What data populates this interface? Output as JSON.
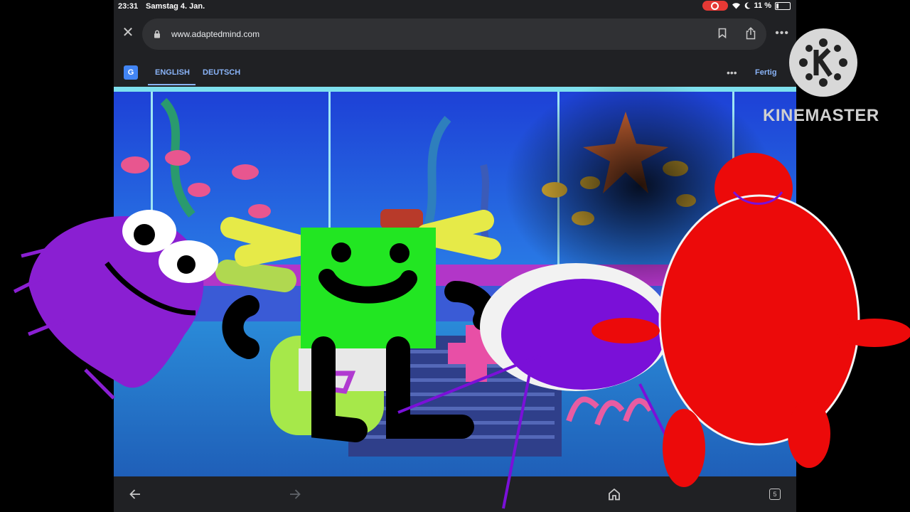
{
  "status": {
    "time": "23:31",
    "date": "Samstag 4. Jan.",
    "battery": "11 %"
  },
  "browser": {
    "url": "www.adaptedmind.com"
  },
  "translate": {
    "tab_english": "ENGLISH",
    "tab_deutsch": "DEUTSCH",
    "done": "Fertig"
  },
  "watermark": {
    "text": "KINEMASTER"
  },
  "bottom": {
    "tabs_count": "5"
  },
  "colors": {
    "accent": "#8ab4f8",
    "toolbar": "#202124",
    "record": "#e53935"
  },
  "icons": [
    "close-icon",
    "lock-icon",
    "bookmark-icon",
    "share-icon",
    "more-icon",
    "google-translate-icon",
    "back-icon",
    "forward-icon",
    "home-icon",
    "tabs-icon"
  ]
}
